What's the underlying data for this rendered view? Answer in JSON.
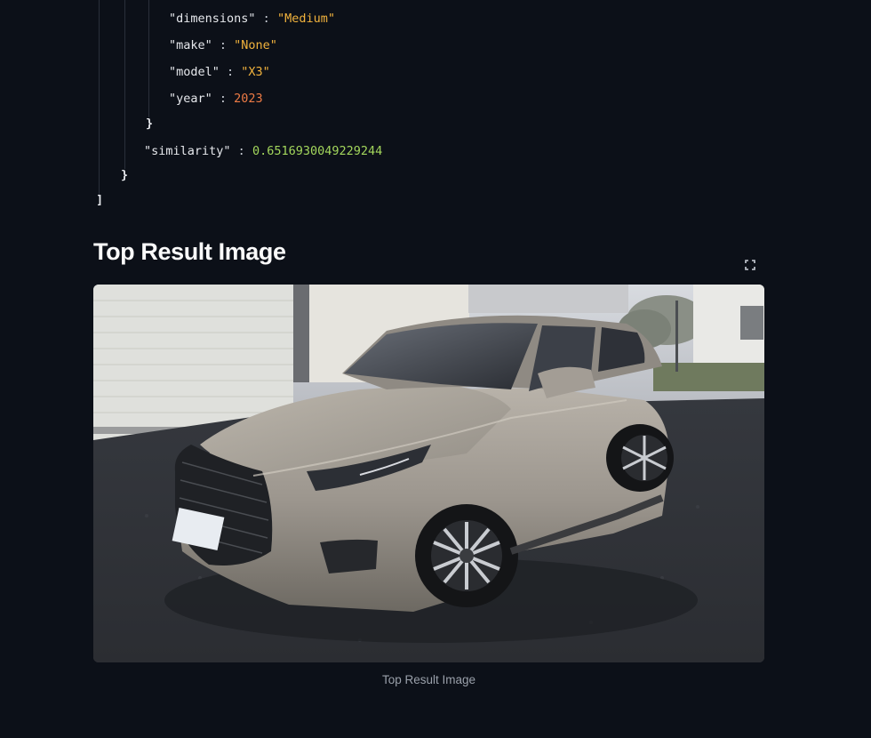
{
  "json_viewer": {
    "lines": [
      {
        "key": "\"dimensions\"",
        "sep": " : ",
        "value": "\"Medium\"",
        "type": "string"
      },
      {
        "key": "\"make\"",
        "sep": " : ",
        "value": "\"None\"",
        "type": "string"
      },
      {
        "key": "\"model\"",
        "sep": " : ",
        "value": "\"X3\"",
        "type": "string"
      },
      {
        "key": "\"year\"",
        "sep": " : ",
        "value": "2023",
        "type": "number"
      },
      {
        "key": "}",
        "sep": "",
        "value": "",
        "type": "bracket"
      },
      {
        "key": "\"similarity\"",
        "sep": " : ",
        "value": "0.6516930049229244",
        "type": "float"
      },
      {
        "key": "}",
        "sep": "",
        "value": "",
        "type": "bracket"
      },
      {
        "key": "]",
        "sep": "",
        "value": "",
        "type": "bracket"
      }
    ]
  },
  "section": {
    "title": "Top Result Image",
    "fullscreen_icon": "fullscreen-icon"
  },
  "image": {
    "caption": "Top Result Image",
    "subject": "car-photo"
  },
  "colors": {
    "background": "#0c1018",
    "string": "#f2b33d",
    "number": "#ee7b45",
    "float": "#a3d65c"
  }
}
